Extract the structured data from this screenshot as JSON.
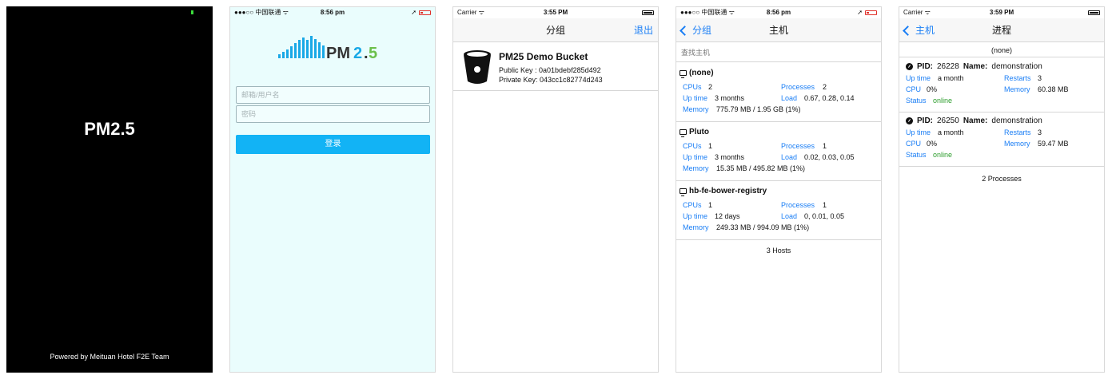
{
  "splash": {
    "title": "PM2.5",
    "footer": "Powered by Meituan Hotel F2E Team"
  },
  "login": {
    "status": {
      "carrier": "●●●○○ 中国联通 ᯤ",
      "time": "8:56 pm",
      "right": "➚ ⌚"
    },
    "logo_text": "PM2.5",
    "email_placeholder": "邮箱/用户名",
    "password_placeholder": "密码",
    "login_button": "登录"
  },
  "buckets": {
    "status": {
      "carrier": "Carrier ᯤ",
      "time": "3:55 PM"
    },
    "nav_title": "分组",
    "logout": "退出",
    "bucket": {
      "name": "PM25 Demo Bucket",
      "public_key": "Public Key : 0a01bdebf285d492",
      "private_key": "Private Key: 043cc1c82774d243"
    }
  },
  "hosts": {
    "status": {
      "carrier": "●●●○○ 中国联通 ᯤ",
      "time": "8:56 pm",
      "right": "➚ ⌚"
    },
    "back": "分组",
    "nav_title": "主机",
    "search_placeholder": "查找主机",
    "labels": {
      "cpus": "CPUs",
      "uptime": "Up time",
      "memory": "Memory",
      "processes": "Processes",
      "load": "Load"
    },
    "items": [
      {
        "name": "(none)",
        "cpus": "2",
        "uptime": "3 months",
        "memory": "775.79 MB / 1.95 GB  (1%)",
        "processes": "2",
        "load": "0.67, 0.28, 0.14"
      },
      {
        "name": "Pluto",
        "cpus": "1",
        "uptime": "3 months",
        "memory": "15.35 MB / 495.82 MB  (1%)",
        "processes": "1",
        "load": "0.02, 0.03, 0.05"
      },
      {
        "name": "hb-fe-bower-registry",
        "cpus": "1",
        "uptime": "12 days",
        "memory": "249.33 MB / 994.09 MB  (1%)",
        "processes": "1",
        "load": "0, 0.01, 0.05"
      }
    ],
    "count": "3 Hosts"
  },
  "processes": {
    "status": {
      "carrier": "Carrier ᯤ",
      "time": "3:59 PM"
    },
    "back": "主机",
    "nav_title": "进程",
    "host_label": "(none)",
    "labels": {
      "pid": "PID:",
      "name": "Name:",
      "uptime": "Up time",
      "cpu": "CPU",
      "status": "Status",
      "restarts": "Restarts",
      "memory": "Memory"
    },
    "items": [
      {
        "pid": "26228",
        "name": "demonstration",
        "uptime": "a month",
        "cpu": "0%",
        "status": "online",
        "restarts": "3",
        "memory": "60.38 MB"
      },
      {
        "pid": "26250",
        "name": "demonstration",
        "uptime": "a month",
        "cpu": "0%",
        "status": "online",
        "restarts": "3",
        "memory": "59.47 MB"
      }
    ],
    "count": "2 Processes"
  },
  "colors": {
    "link": "#1a7ef5",
    "login_button": "#12b3f5",
    "online": "#2f9e2f",
    "logo_blue": "#1aa9e6",
    "logo_green": "#6bc04b"
  }
}
